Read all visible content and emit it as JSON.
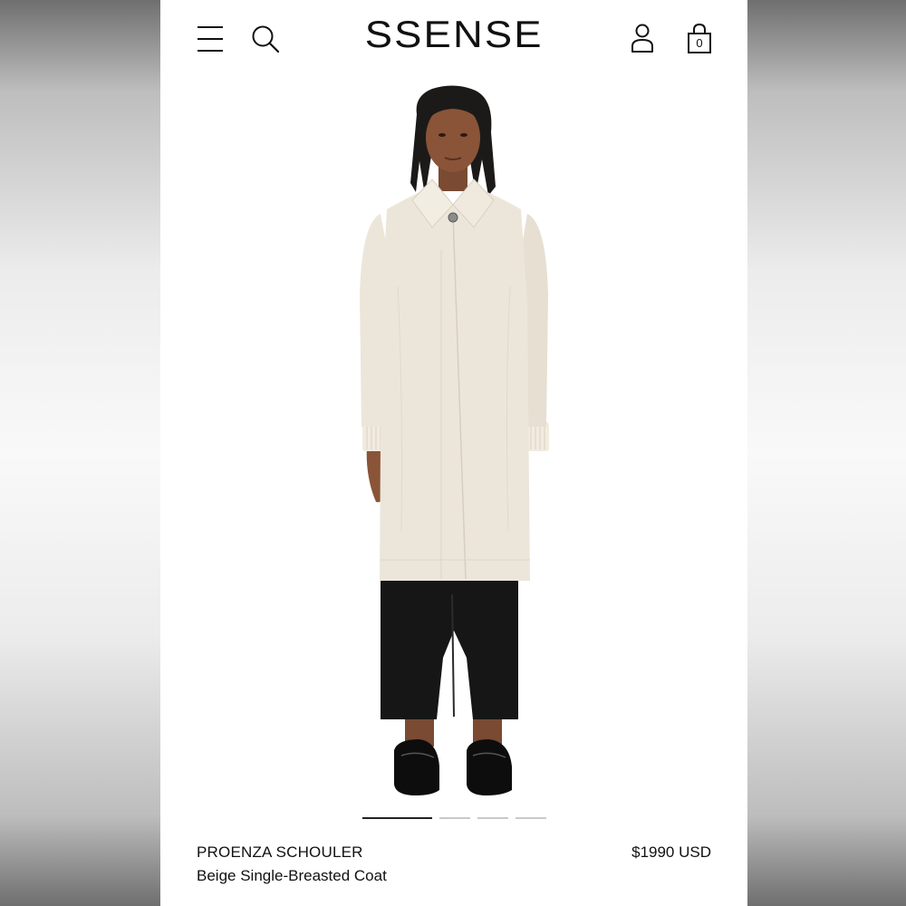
{
  "header": {
    "logo": "SSENSE",
    "bag_count": "0",
    "icons": [
      "menu-icon",
      "search-icon",
      "account-icon",
      "shopping-bag-icon"
    ]
  },
  "product": {
    "brand": "PROENZA SCHOULER",
    "name": "Beige Single-Breasted Coat",
    "price": "$1990 USD",
    "image_count": 4,
    "active_image": 1
  },
  "colors": {
    "coat": "#ece6da",
    "pants": "#161616",
    "background": "#ffffff",
    "text": "#111111"
  }
}
